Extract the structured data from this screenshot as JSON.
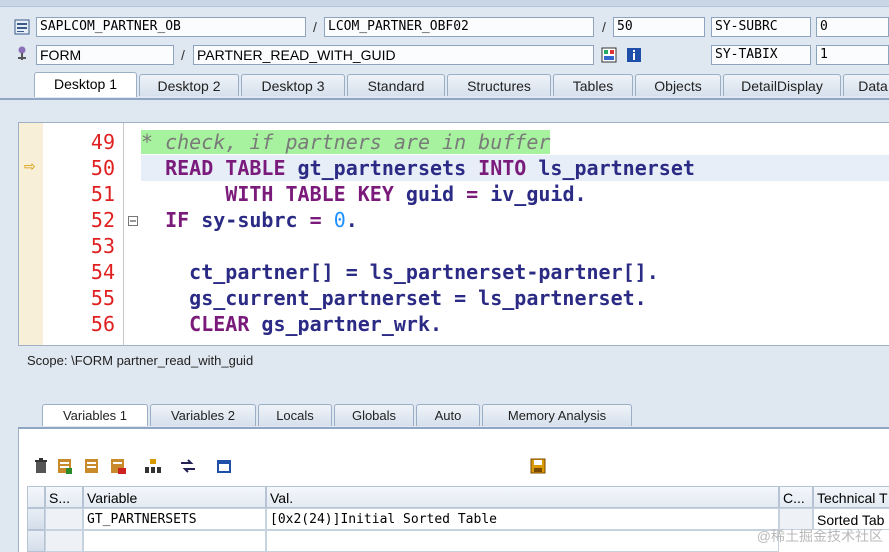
{
  "header": {
    "row1": {
      "program": "SAPLCOM_PARTNER_OB",
      "sep1": "/",
      "include": "LCOM_PARTNER_OBF02",
      "sep2": "/",
      "line": "50",
      "sysfield": "SY-SUBRC",
      "sysvalue": "0"
    },
    "row2": {
      "type": "FORM",
      "sep1": "/",
      "event": "PARTNER_READ_WITH_GUID",
      "sysfield": "SY-TABIX",
      "sysvalue": "1"
    }
  },
  "tabs": [
    "Desktop 1",
    "Desktop 2",
    "Desktop 3",
    "Standard",
    "Structures",
    "Tables",
    "Objects",
    "DetailDisplay",
    "Data"
  ],
  "editor": {
    "lines": [
      {
        "no": "49",
        "segments": [
          {
            "cls": "cmt",
            "t": "* check, if partners are in buffer"
          }
        ]
      },
      {
        "no": "50",
        "segments": [
          {
            "cls": "kw",
            "t": "  READ TABLE "
          },
          {
            "cls": "",
            "t": "gt_partnersets "
          },
          {
            "cls": "kw",
            "t": "INTO "
          },
          {
            "cls": "",
            "t": "ls_partnerset"
          }
        ]
      },
      {
        "no": "51",
        "segments": [
          {
            "cls": "kw",
            "t": "       WITH TABLE KEY "
          },
          {
            "cls": "",
            "t": "guid "
          },
          {
            "cls": "kw",
            "t": "= "
          },
          {
            "cls": "",
            "t": "iv_guid."
          }
        ]
      },
      {
        "no": "52",
        "segments": [
          {
            "cls": "kw",
            "t": "  IF "
          },
          {
            "cls": "",
            "t": "sy-subrc "
          },
          {
            "cls": "kw",
            "t": "= "
          },
          {
            "cls": "num",
            "t": "0"
          },
          {
            "cls": "",
            "t": "."
          }
        ]
      },
      {
        "no": "53",
        "segments": []
      },
      {
        "no": "54",
        "segments": [
          {
            "cls": "",
            "t": "    ct_partner[] = ls_partnerset-partner[]."
          }
        ]
      },
      {
        "no": "55",
        "segments": [
          {
            "cls": "",
            "t": "    gs_current_partnerset = ls_partnerset."
          }
        ]
      },
      {
        "no": "56",
        "segments": [
          {
            "cls": "kw",
            "t": "    CLEAR "
          },
          {
            "cls": "",
            "t": "gs_partner_wrk."
          }
        ]
      }
    ]
  },
  "scope": "Scope: \\FORM partner_read_with_guid",
  "bottom_tabs": [
    "Variables 1",
    "Variables 2",
    "Locals",
    "Globals",
    "Auto",
    "Memory Analysis"
  ],
  "grid": {
    "headers": [
      "S...",
      "Variable",
      "Val.",
      "C...",
      "Technical T"
    ],
    "rows": [
      {
        "variable": "GT_PARTNERSETS",
        "value": "[0x2(24)]Initial Sorted Table",
        "tech": "Sorted Tab"
      }
    ]
  },
  "watermark": "@稀土掘金技术社区"
}
